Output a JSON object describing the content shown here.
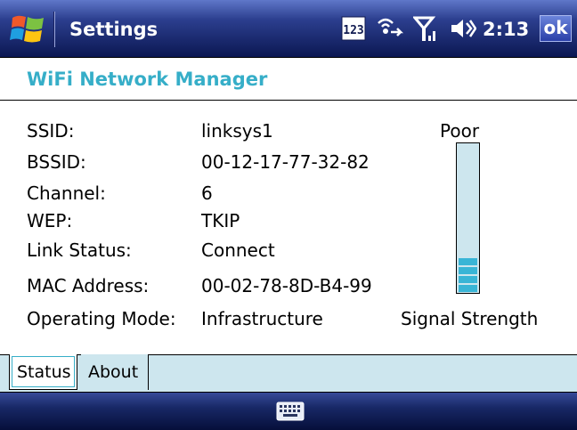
{
  "taskbar": {
    "title": "Settings",
    "clock": "2:13",
    "ok_label": "ok",
    "icons": [
      "windows-start-icon",
      "ime-123-icon",
      "connectivity-icon",
      "signal-icon",
      "volume-icon"
    ]
  },
  "header": {
    "title": "WiFi Network Manager"
  },
  "info": {
    "rows": [
      {
        "label": "SSID:",
        "value": "linksys1"
      },
      {
        "label": "BSSID:",
        "value": "00-12-17-77-32-82"
      },
      {
        "label": "Channel:",
        "value": "6"
      },
      {
        "label": "WEP:",
        "value": "TKIP"
      },
      {
        "label": "Link Status:",
        "value": "Connect"
      },
      {
        "label": "MAC Address:",
        "value": "00-02-78-8D-B4-99"
      },
      {
        "label": "Operating Mode:",
        "value": "Infrastructure"
      }
    ]
  },
  "signal": {
    "quality": "Poor",
    "caption": "Signal Strength",
    "level_bars": 4,
    "max_bars": 16,
    "bar_color": "#39b5d6",
    "meter_bg": "#cde6ee"
  },
  "tabs": [
    {
      "label": "Status",
      "selected": true
    },
    {
      "label": "About",
      "selected": false
    }
  ],
  "colors": {
    "accent": "#36aec8",
    "tab_bg": "#cde6ee"
  }
}
